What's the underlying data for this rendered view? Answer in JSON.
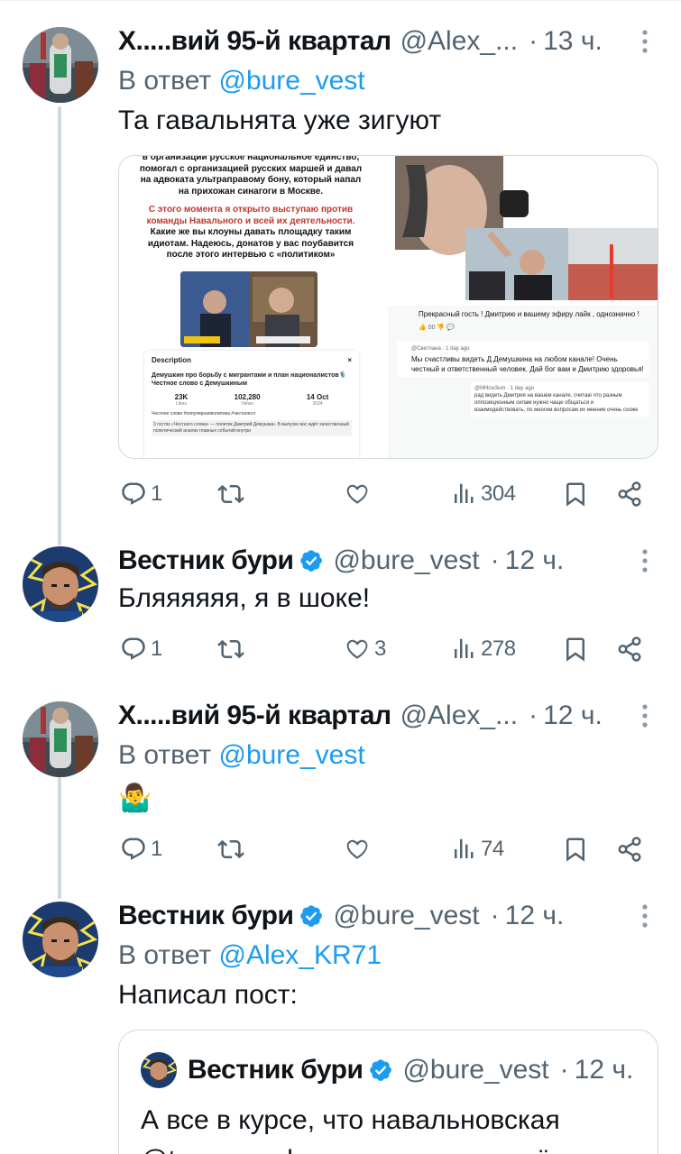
{
  "tweets": [
    {
      "name": "Х.....вий 95-й квартал",
      "handle": "@Alex_...",
      "time": "13 ч.",
      "reply_prefix": "В ответ",
      "reply_to": "@bure_vest",
      "text": "Та гавальнята уже зигуют",
      "replies": "1",
      "retweets": "",
      "likes": "",
      "views": "304",
      "media_left": {
        "lines_top": [
          "в организации русское национальное единство,",
          "помогал с организацией русских маршей и давал",
          "на адвоката ультраправому бону, который напал",
          "на прихожан синагоги в Москве."
        ],
        "lines_red_1": "С этого момента я открыто выступаю против",
        "lines_red_2": "команды Навального и всей их деятельности.",
        "lines_bottom": [
          "Какие же вы клоуны давать площадку таким",
          "идиотам. Надеюсь, донатов у вас поубавится",
          "после этого интервью с «политиком»"
        ],
        "card_title": "Description",
        "card_close": "×",
        "card_desc": "Демушкин про борьбу с мигрантами и план националистов🎙️ Честное слово с Демушкиным",
        "stats": [
          {
            "value": "23K",
            "label": "Likes"
          },
          {
            "value": "102,280",
            "label": "Views"
          },
          {
            "value": "14 Oct",
            "label": "2024"
          }
        ],
        "tags": "Честное слово   #популярнаяполитика   #честноесл",
        "card_foot": "3 гостях «Честного слова» — политик Дмитрий Демушкин. В выпуске вас ждёт качественный политический анализ главных событий внутри"
      },
      "media_right": {
        "comment1": "Прекрасный гость ! Дмитрию и вашему эфиру лайк , однозначно !",
        "comment1_likes": "00",
        "c2_author": "@Светлана · 1 day ago",
        "c2_text": "Мы счастливы видеть Д.Демушкина на любом канале! Очень честный и ответственный человек. Дай бог вам и Дмитрию здоровья!",
        "c3_author": "@MHcw3um · 1 day ago",
        "c3_text": "рад видеть Дмитрия на вашем канале, считаю что разным оппозиционным силам нужно чаще общаться и взаимодействовать, по многим вопросам их мнение очень схоже"
      }
    },
    {
      "name": "Вестник бури",
      "handle": "@bure_vest",
      "time": "12 ч.",
      "text": "Бляяяяяя, я в шоке!",
      "replies": "1",
      "retweets": "",
      "likes": "3",
      "views": "278"
    },
    {
      "name": "Х.....вий 95-й квартал",
      "handle": "@Alex_...",
      "time": "12 ч.",
      "reply_prefix": "В ответ",
      "reply_to": "@bure_vest",
      "text": "🤷‍♂️",
      "replies": "1",
      "retweets": "",
      "likes": "",
      "views": "74"
    },
    {
      "name": "Вестник бури",
      "handle": "@bure_vest",
      "time": "12 ч.",
      "reply_prefix": "В ответ",
      "reply_to": "@Alex_KR71",
      "text": "Написал пост:",
      "quote": {
        "name": "Вестник бури",
        "handle": "@bure_vest",
        "time": "12 ч.",
        "text": "А все в курсе, что навальновская @teamnavalny выкатила на своём"
      }
    }
  ],
  "icons": [
    "reply-icon",
    "retweet-icon",
    "like-icon",
    "views-icon",
    "bookmark-icon",
    "share-icon",
    "verified-icon",
    "more-icon"
  ],
  "colors": {
    "text": "#0f1419",
    "secondary": "#536471",
    "link": "#1d9bf0",
    "border": "#cfd9de",
    "thread": "#cfd9de"
  }
}
